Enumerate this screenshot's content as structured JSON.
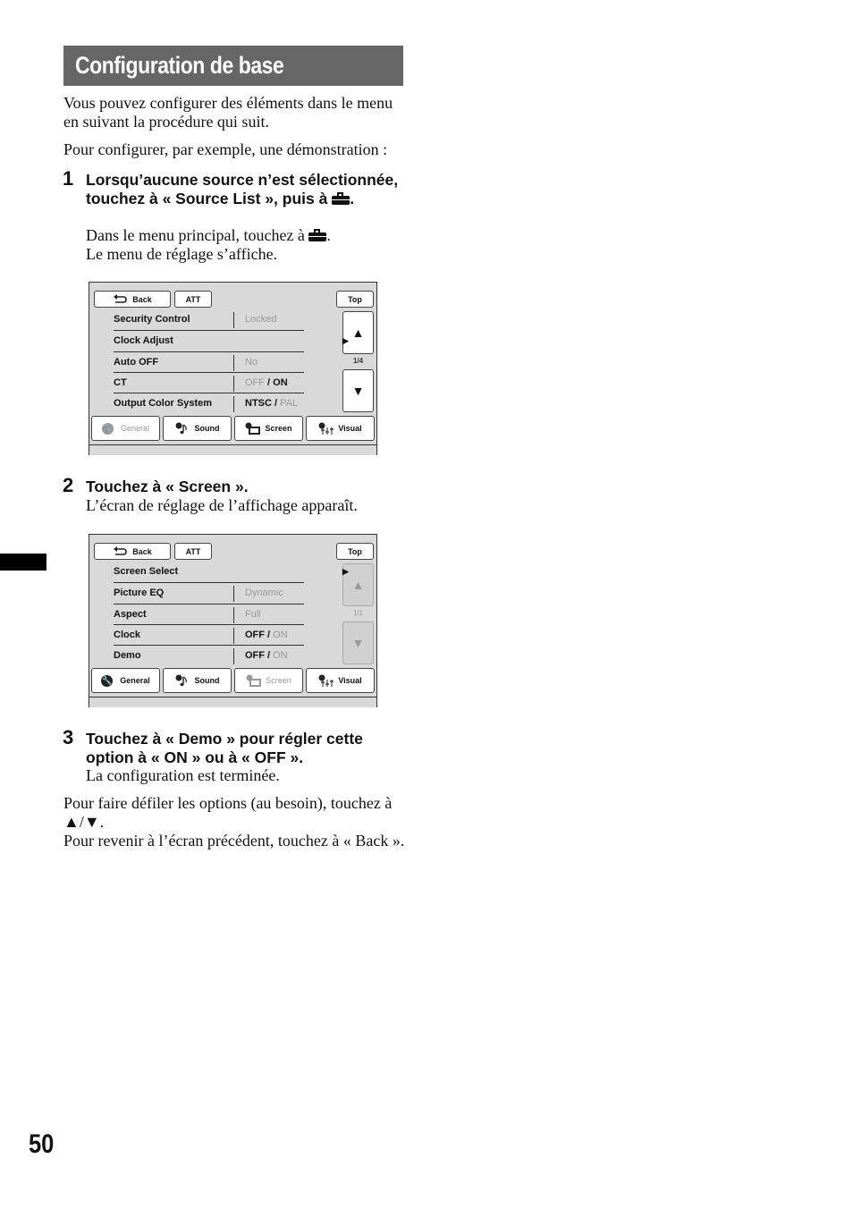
{
  "title": "Configuration de base",
  "intro": [
    "Vous pouvez configurer des éléments dans le menu en suivant la procédure qui suit.",
    "Pour configurer, par exemple, une démonstration :"
  ],
  "steps": [
    {
      "number": "1",
      "heading_before_icon": "Lorsqu’aucune source n’est sélectionnée, touchez à « Source List », puis à",
      "heading_icon": "toolbox-icon",
      "heading_after_icon": ".",
      "body_line1_before_icon": "Dans le menu principal, touchez à",
      "body_line1_after_icon": ".",
      "body_line2": "Le menu de réglage s’affiche."
    },
    {
      "number": "2",
      "heading": "Touchez à « Screen ».",
      "body": "L’écran de réglage de l’affichage apparaît."
    },
    {
      "number": "3",
      "heading": "Touchez à « Demo » pour régler cette option à « ON » ou à « OFF ».",
      "body": "La configuration est terminée."
    }
  ],
  "footer_notes": [
    "Pour faire défiler les options (au besoin), touchez à ▲/▼.",
    "Pour revenir à l’écran précédent, touchez à « Back »."
  ],
  "screens": [
    {
      "buttons": {
        "back": "Back",
        "att": "ATT",
        "top": "Top"
      },
      "page_indicator": "1/4",
      "scroll_enabled": true,
      "rows": [
        {
          "label": "Security Control",
          "value_parts": [
            {
              "text": "Locked",
              "dim": true
            }
          ]
        },
        {
          "label": "Clock Adjust",
          "has_submenu": true,
          "submenu_arrow": "▶"
        },
        {
          "label": "Auto OFF",
          "value_parts": [
            {
              "text": "No",
              "dim": true
            }
          ]
        },
        {
          "label": "CT",
          "value_parts": [
            {
              "text": "OFF",
              "dim": true
            },
            {
              "text": " / ON",
              "dim": false
            }
          ]
        },
        {
          "label": "Output Color System",
          "value_parts": [
            {
              "text": "NTSC / ",
              "dim": false
            },
            {
              "text": "PAL",
              "dim": true
            }
          ]
        }
      ],
      "tabs": [
        {
          "label": "General",
          "icon": "wrench-icon",
          "active": true
        },
        {
          "label": "Sound",
          "icon": "music-note-icon",
          "active": false
        },
        {
          "label": "Screen",
          "icon": "screen-icon",
          "active": false
        },
        {
          "label": "Visual",
          "icon": "equalizer-icon",
          "active": false
        }
      ]
    },
    {
      "buttons": {
        "back": "Back",
        "att": "ATT",
        "top": "Top"
      },
      "page_indicator": "1/1",
      "scroll_enabled": false,
      "rows": [
        {
          "label": "Screen Select",
          "has_submenu": true,
          "submenu_arrow": "▶"
        },
        {
          "label": "Picture EQ",
          "value_parts": [
            {
              "text": "Dynamic",
              "dim": true
            }
          ]
        },
        {
          "label": "Aspect",
          "value_parts": [
            {
              "text": "Full",
              "dim": true
            }
          ]
        },
        {
          "label": "Clock",
          "value_parts": [
            {
              "text": "OFF / ",
              "dim": false
            },
            {
              "text": "ON",
              "dim": true
            }
          ]
        },
        {
          "label": "Demo",
          "value_parts": [
            {
              "text": "OFF / ",
              "dim": false
            },
            {
              "text": "ON",
              "dim": true
            }
          ]
        }
      ],
      "tabs": [
        {
          "label": "General",
          "icon": "wrench-icon",
          "active": false
        },
        {
          "label": "Sound",
          "icon": "music-note-icon",
          "active": false
        },
        {
          "label": "Screen",
          "icon": "screen-icon",
          "active": true
        },
        {
          "label": "Visual",
          "icon": "equalizer-icon",
          "active": false
        }
      ]
    }
  ],
  "scroll_up_glyph": "▲",
  "scroll_down_glyph": "▼",
  "page_number": "50"
}
